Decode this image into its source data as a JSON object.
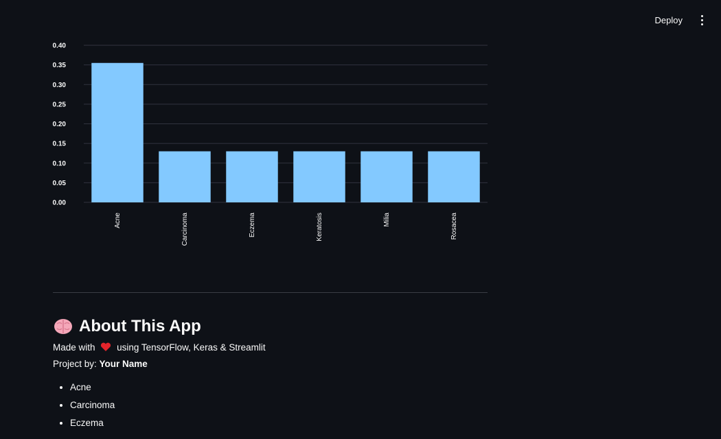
{
  "toolbar": {
    "deploy_label": "Deploy",
    "menu_icon": "more-vert-icon"
  },
  "chart_data": {
    "type": "bar",
    "categories": [
      "Acne",
      "Carcinoma",
      "Eczema",
      "Keratosis",
      "Milia",
      "Rosacea"
    ],
    "values": [
      0.355,
      0.13,
      0.13,
      0.13,
      0.13,
      0.13
    ],
    "ylim": [
      0,
      0.4
    ],
    "yticks": [
      0.0,
      0.05,
      0.1,
      0.15,
      0.2,
      0.25,
      0.3,
      0.35,
      0.4
    ],
    "ytick_labels": [
      "0.00",
      "0.05",
      "0.10",
      "0.15",
      "0.20",
      "0.25",
      "0.30",
      "0.35",
      "0.40"
    ],
    "bar_color": "#83c9ff",
    "grid": true,
    "title": "",
    "xlabel": "",
    "ylabel": ""
  },
  "about": {
    "icon": "brain-icon",
    "title": "About This App",
    "made_with_prefix": "Made with",
    "made_with_icon": "heart-icon",
    "made_with_suffix": "using TensorFlow, Keras & Streamlit",
    "project_by_label": "Project by:",
    "project_by_name": "Your Name",
    "list_items": [
      "Acne",
      "Carcinoma",
      "Eczema"
    ]
  }
}
